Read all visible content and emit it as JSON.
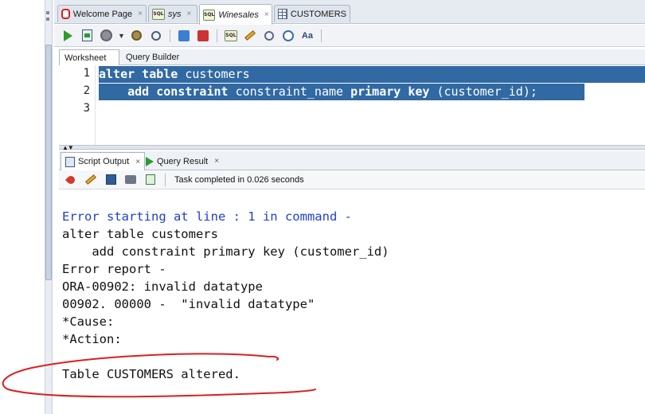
{
  "doc_tabs": [
    {
      "label": "Welcome Page",
      "icon": "oracle-icon",
      "active": false
    },
    {
      "label": "sys",
      "icon": "sql-worksheet-icon",
      "active": false
    },
    {
      "label": "Winesales",
      "icon": "sql-worksheet-icon",
      "active": true
    },
    {
      "label": "CUSTOMERS",
      "icon": "table-icon",
      "active": false
    }
  ],
  "close_glyph": "×",
  "sub_tabs": {
    "worksheet": "Worksheet",
    "query_builder": "Query Builder"
  },
  "editor": {
    "line_numbers": [
      "1",
      "2",
      "3"
    ],
    "line1": {
      "kw1": "alter table",
      "rest": " customers"
    },
    "line2": {
      "indent": "    ",
      "kw1": "add constraint",
      "mid": " constraint_name ",
      "kw2": "primary key",
      "rest": " (customer_id);"
    }
  },
  "output_tabs": {
    "script_output": "Script Output",
    "query_result": "Query Result"
  },
  "output_toolbar": {
    "status": "Task completed in 0.026 seconds"
  },
  "output_lines": [
    "Error starting at line : 1 in command -",
    "alter table customers",
    "    add constraint primary key (customer_id)",
    "Error report -",
    "ORA-00902: invalid datatype",
    "00902. 00000 -  \"invalid datatype\"",
    "*Cause:",
    "*Action:",
    "",
    "Table CUSTOMERS altered."
  ],
  "colors": {
    "selection": "#3169a3",
    "error_text": "#1f3fd0",
    "annotation": "#d92020"
  }
}
